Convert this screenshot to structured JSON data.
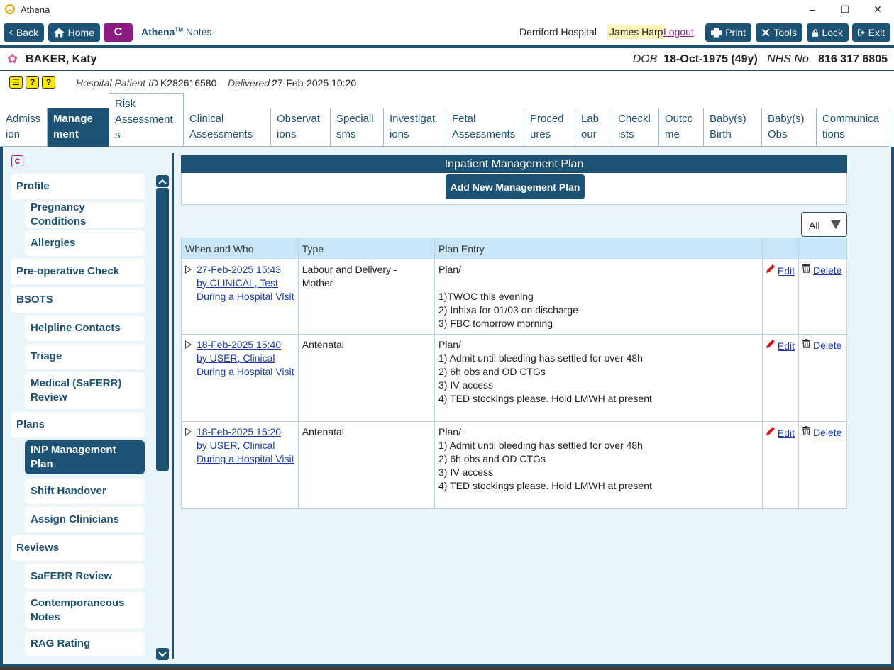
{
  "window": {
    "title": "Athena",
    "controls": {
      "minimize": "–",
      "maximize": "☐",
      "close": "✕"
    }
  },
  "toolbar": {
    "back": "Back",
    "home": "Home",
    "c_button": "C",
    "brand_name": "Athena",
    "brand_tm": "TM",
    "brand_suffix": "Notes",
    "hospital": "Derriford Hospital",
    "user": "James Harp",
    "logout": "Logout",
    "print": "Print",
    "tools": "Tools",
    "lock": "Lock",
    "exit": "Exit"
  },
  "patient": {
    "name": "BAKER, Katy",
    "dob_label": "DOB",
    "dob": "18-Oct-1975 (49y)",
    "nhs_label": "NHS No.",
    "nhs": "816 317 6805",
    "hospital_id_label": "Hospital Patient ID",
    "hospital_id": "K282616580",
    "delivered_label": "Delivered",
    "delivered": "27-Feb-2025 10:20",
    "alert_icons": [
      "?",
      "?",
      "?"
    ]
  },
  "tabs": [
    {
      "l1": "Admiss",
      "l2": "ion"
    },
    {
      "l1": "Manage",
      "l2": "ment"
    },
    {
      "l1": "Risk",
      "l2": "Assessment",
      "l3": "s"
    },
    {
      "l1": "Clinical",
      "l2": "Assessments"
    },
    {
      "l1": "Observat",
      "l2": "ions"
    },
    {
      "l1": "Speciali",
      "l2": "sms"
    },
    {
      "l1": "Investigat",
      "l2": "ions"
    },
    {
      "l1": "Fetal",
      "l2": "Assessments"
    },
    {
      "l1": "Proced",
      "l2": "ures"
    },
    {
      "l1": "Lab",
      "l2": "our"
    },
    {
      "l1": "Checkl",
      "l2": "ists"
    },
    {
      "l1": "Outco",
      "l2": "me"
    },
    {
      "l1": "Baby(s)",
      "l2": "Birth"
    },
    {
      "l1": "Baby(s)",
      "l2": "Obs"
    },
    {
      "l1": "Communica",
      "l2": "tions"
    }
  ],
  "sidebar": {
    "c_icon": "C",
    "items": [
      "Profile",
      "Pregnancy Conditions",
      "Allergies",
      "Pre-operative Check",
      "BSOTS",
      "Helpline Contacts",
      "Triage",
      "Medical (SaFERR) Review",
      "Plans",
      "INP Management Plan",
      "Shift Handover",
      "Assign Clinicians",
      "Reviews",
      "SaFERR Review",
      "Contemporaneous Notes",
      "RAG Rating"
    ]
  },
  "content": {
    "panel_title": "Inpatient Management Plan",
    "add_button": "Add New Management Plan",
    "filter_value": "All",
    "columns": [
      "When and Who",
      "Type",
      "Plan Entry",
      "",
      ""
    ],
    "edit_label": "Edit",
    "delete_label": "Delete",
    "rows": [
      {
        "when": "27-Feb-2025 15:43",
        "by": "by CLINICAL, Test",
        "context": "During a Hospital Visit",
        "type": "Labour and Delivery - Mother",
        "entry": [
          "Plan/",
          "",
          "1)TWOC this evening",
          "2) Inhixa for 01/03 on discharge",
          "3) FBC tomorrow morning"
        ]
      },
      {
        "when": "18-Feb-2025 15:40",
        "by": "by USER, Clinical",
        "context": "During a Hospital Visit",
        "type": "Antenatal",
        "entry": [
          "Plan/",
          "1) Admit until bleeding has settled for over 48h",
          "2) 6h obs and OD CTGs",
          "3) IV access",
          "4) TED stockings please. Hold LMWH at present"
        ]
      },
      {
        "when": "18-Feb-2025 15:20",
        "by": "by USER, Clinical",
        "context": "During a Hospital Visit",
        "type": "Antenatal",
        "entry": [
          "Plan/",
          "1) Admit until bleeding has settled for over 48h",
          "2) 6h obs and OD CTGs",
          "3) IV access",
          "4) TED stockings please. Hold LMWH at present"
        ]
      }
    ]
  }
}
